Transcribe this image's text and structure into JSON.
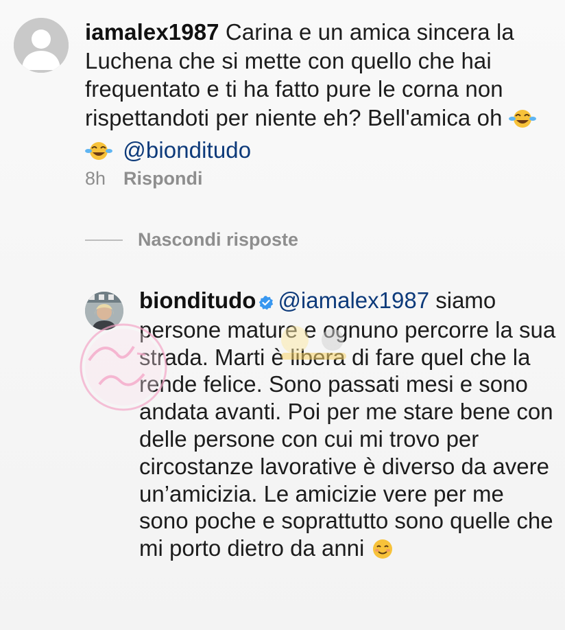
{
  "comment": {
    "username": "iamalex1987",
    "text": " Carina e un amica sincera la Luchena che si mette con quello che hai frequentato e ti ha fatto pure le corna non rispettandoti per niente eh? Bell'amica oh ",
    "emojis": [
      "face-with-tears-of-joy",
      "face-with-tears-of-joy"
    ],
    "mention": "@bionditudo",
    "time": "8h",
    "reply_label": "Rispondi"
  },
  "thread": {
    "hide_replies_label": "Nascondi risposte"
  },
  "reply": {
    "username": "bionditudo",
    "verified": true,
    "mention": "@iamalex1987",
    "text": " siamo persone mature e ognuno percorre la sua strada. Marti è libera di fare quel che la rende felice. Sono passati mesi e sono andata avanti. Poi per me stare bene con delle persone con cui mi trovo per circostanze lavorative è diverso da avere un’amicizia. Le amicizie vere per me sono poche e soprattutto sono quelle che mi porto dietro da anni ",
    "emoji": "smiling-face"
  },
  "colors": {
    "background": "#f7f7f7",
    "text": "#1c1c1c",
    "muted": "#8e8e8e",
    "mention": "#0d3a7a",
    "verified": "#3897f0",
    "watermark_pink": "#f4a7c8"
  }
}
